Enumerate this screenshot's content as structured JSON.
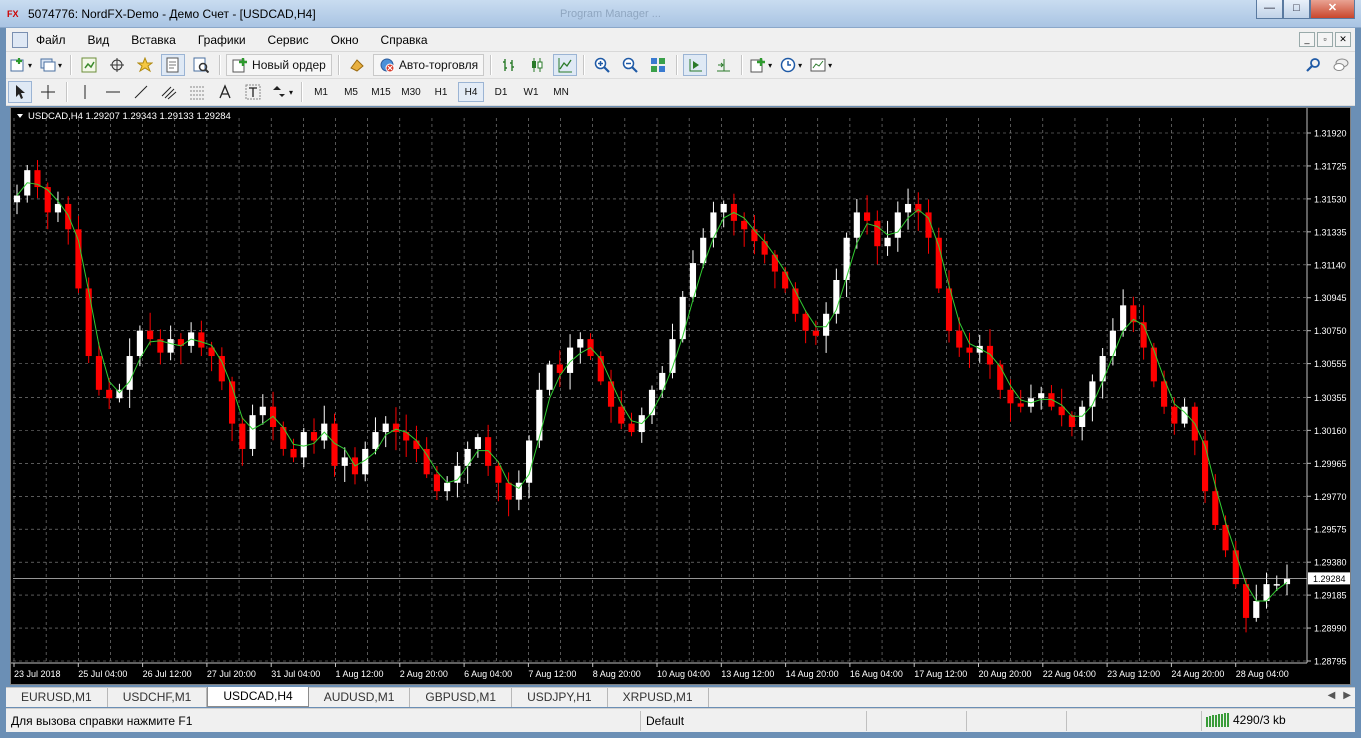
{
  "window": {
    "title": "5074776: NordFX-Demo - Демо Счет - [USDCAD,H4]",
    "ghost_title": "Program Manager ...",
    "controls": {
      "minimize": "—",
      "maximize": "□",
      "close": "✕"
    }
  },
  "menu": {
    "items": [
      {
        "label": "Файл"
      },
      {
        "label": "Вид"
      },
      {
        "label": "Вставка"
      },
      {
        "label": "Графики"
      },
      {
        "label": "Сервис"
      },
      {
        "label": "Окно"
      },
      {
        "label": "Справка"
      }
    ]
  },
  "toolbar": {
    "new_order_label": "Новый ордер",
    "auto_trading_label": "Авто-торговля"
  },
  "timeframes": [
    "M1",
    "M5",
    "M15",
    "M30",
    "H1",
    "H4",
    "D1",
    "W1",
    "MN"
  ],
  "active_timeframe": "H4",
  "tabs": [
    {
      "label": "EURUSD,M1"
    },
    {
      "label": "USDCHF,M1"
    },
    {
      "label": "USDCAD,H4",
      "active": true
    },
    {
      "label": "AUDUSD,M1"
    },
    {
      "label": "GBPUSD,M1"
    },
    {
      "label": "USDJPY,H1"
    },
    {
      "label": "XRPUSD,M1"
    }
  ],
  "status": {
    "help": "Для вызова справки нажмите F1",
    "profile": "Default",
    "connection": "4290/3 kb"
  },
  "colors": {
    "background": "#000000",
    "grid": "#c0c0c0",
    "bull": "#ffffff",
    "bear": "#ff0000",
    "ma": "#32cd32",
    "text": "#ffffff"
  },
  "chart_data": {
    "type": "candlestick",
    "symbol_label": "USDCAD,H4  1.29207 1.29343 1.29133 1.29284",
    "current_price": "1.29284",
    "y_ticks": [
      "1.31920",
      "1.31725",
      "1.31530",
      "1.31335",
      "1.31140",
      "1.30945",
      "1.30750",
      "1.30555",
      "1.30355",
      "1.30160",
      "1.29965",
      "1.29770",
      "1.29575",
      "1.29380",
      "1.29185",
      "1.28990",
      "1.28795"
    ],
    "ylim": [
      1.28795,
      1.3192
    ],
    "x_ticks": [
      "23 Jul 2018",
      "25 Jul 04:00",
      "26 Jul 12:00",
      "27 Jul 20:00",
      "31 Jul 04:00",
      "1 Aug 12:00",
      "2 Aug 20:00",
      "6 Aug 04:00",
      "7 Aug 12:00",
      "8 Aug 20:00",
      "10 Aug 04:00",
      "13 Aug 12:00",
      "14 Aug 20:00",
      "16 Aug 04:00",
      "17 Aug 12:00",
      "20 Aug 20:00",
      "22 Aug 04:00",
      "23 Aug 12:00",
      "24 Aug 20:00",
      "28 Aug 04:00"
    ],
    "series": [
      {
        "name": "price",
        "close_path": [
          1.3155,
          1.317,
          1.316,
          1.3145,
          1.315,
          1.3135,
          1.31,
          1.306,
          1.304,
          1.3035,
          1.304,
          1.306,
          1.3075,
          1.307,
          1.3062,
          1.307,
          1.3066,
          1.3074,
          1.3065,
          1.306,
          1.3045,
          1.302,
          1.3005,
          1.3025,
          1.303,
          1.3018,
          1.3005,
          1.3,
          1.3015,
          1.301,
          1.302,
          1.2995,
          1.3,
          1.299,
          1.3005,
          1.3015,
          1.302,
          1.3015,
          1.301,
          1.3005,
          1.299,
          1.298,
          1.2985,
          1.2995,
          1.3005,
          1.3012,
          1.2995,
          1.2985,
          1.2975,
          1.2985,
          1.301,
          1.304,
          1.3055,
          1.305,
          1.3065,
          1.307,
          1.306,
          1.3045,
          1.303,
          1.302,
          1.3015,
          1.3025,
          1.304,
          1.305,
          1.307,
          1.3095,
          1.3115,
          1.313,
          1.3145,
          1.315,
          1.314,
          1.3135,
          1.3128,
          1.312,
          1.311,
          1.31,
          1.3085,
          1.3075,
          1.3072,
          1.3085,
          1.3105,
          1.313,
          1.3145,
          1.314,
          1.3125,
          1.313,
          1.3145,
          1.315,
          1.3145,
          1.313,
          1.31,
          1.3075,
          1.3065,
          1.3062,
          1.3066,
          1.3055,
          1.304,
          1.3032,
          1.303,
          1.3035,
          1.3038,
          1.303,
          1.3025,
          1.3018,
          1.303,
          1.3045,
          1.306,
          1.3075,
          1.309,
          1.308,
          1.3065,
          1.3045,
          1.303,
          1.302,
          1.303,
          1.301,
          1.298,
          1.296,
          1.2945,
          1.2925,
          1.2905,
          1.2915,
          1.2925,
          1.2925,
          1.2928
        ]
      }
    ]
  }
}
